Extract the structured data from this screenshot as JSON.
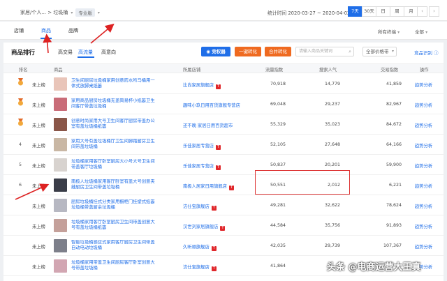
{
  "breadcrumb": {
    "path": "家居/个人... > 垃圾桶",
    "badge": "专业版"
  },
  "date": {
    "range": "统计时间 2020-03-27 ~ 2020-04-02",
    "buttons": [
      "7天",
      "30天",
      "日",
      "周",
      "月"
    ],
    "active": "7天"
  },
  "nav": {
    "tabs": [
      "店铺",
      "商品",
      "品牌"
    ],
    "active": "商品",
    "filters": [
      "所有终端",
      "全部"
    ]
  },
  "section": {
    "title": "商品排行",
    "tabs": [
      "高交易",
      "高流量",
      "高意向"
    ],
    "active_tab": "高流量",
    "logo": "竞权器",
    "btn1": "一键转化",
    "btn2": "合并转化",
    "search_placeholder": "请输入商品关键词",
    "select": "全部价格带",
    "explain": "竞品识别"
  },
  "columns": [
    "排名",
    "商品",
    "所属店铺",
    "流量指数",
    "搜索人气",
    "交易指数",
    "操作"
  ],
  "rows": [
    {
      "rank": "",
      "medal": true,
      "status": "未上榜",
      "name": "卫生间厨房垃圾桶家用创意防水所马桶用一体式放脚桌纸篓",
      "shop": "比尚家居旗舰店",
      "tmall": true,
      "flow": "70,918",
      "search": "14,779",
      "trade": "41,859",
      "op": "趋势分析",
      "thumb": "#e9c5b9"
    },
    {
      "rank": "",
      "medal": true,
      "status": "未上榜",
      "name": "家用商品厨房垃圾桶无盖简易杯小纸篓卫生间客厅带盖垃圾桶",
      "shop": "趣味小玖日用百货旗舰专营店",
      "tmall": false,
      "flow": "69,048",
      "search": "29,237",
      "trade": "82,967",
      "op": "趋势分析",
      "thumb": "#c96c78"
    },
    {
      "rank": "",
      "medal": true,
      "status": "未上榜",
      "name": "创意时尚家用大号卫生间客厅厨房带盖办公室有盖垃圾桶纸篓",
      "shop": "还不晚 家居日用百货超市",
      "tmall": false,
      "flow": "55,329",
      "search": "35,023",
      "trade": "84,672",
      "op": "趋势分析",
      "thumb": "#8a5648"
    },
    {
      "rank": "4",
      "medal": false,
      "status": "未上榜",
      "name": "家用大号有盖垃圾桶厅卫生间脚踏厨房卫生间带盖垃圾桶",
      "shop": "乐佳家居专营店",
      "tmall": true,
      "flow": "52,105",
      "search": "27,648",
      "trade": "64,166",
      "op": "趋势分析",
      "thumb": "#c9b7a4"
    },
    {
      "rank": "5",
      "medal": false,
      "status": "未上榜",
      "name": "垃圾桶家用客厅卧室厨房大小号大号卫生间带盖客厅垃圾桶",
      "shop": "乐佳家居专营店",
      "tmall": true,
      "flow": "50,837",
      "search": "20,201",
      "trade": "59,900",
      "op": "趋势分析",
      "thumb": "#d8d3cf"
    },
    {
      "rank": "6",
      "medal": false,
      "status": "未上榜",
      "name": "南极人垃圾桶家用客厅卧室有盖大号创意夹缝厨房卫生间带盖垃圾桶",
      "shop": "南极人居家日用旗舰店",
      "tmall": true,
      "flow": "50,551",
      "search": "2,012",
      "trade": "6,221",
      "op": "趋势分析",
      "thumb": "#3a3d48"
    },
    {
      "rank": "",
      "medal": false,
      "status": "未上榜",
      "name": "厨房垃圾桶挂式分类家用橱柜门挂壁式纸篓垃圾桶带盖厨余垃圾桶",
      "shop": "洁仕宝旗舰店",
      "tmall": true,
      "flow": "49,281",
      "search": "32,622",
      "trade": "78,624",
      "op": "趋势分析",
      "thumb": "#b7b8c2"
    },
    {
      "rank": "",
      "medal": false,
      "status": "未上榜",
      "name": "垃圾桶家用客厅卧室厨房卫生间带盖创意大号有盖垃圾桶纸篓",
      "shop": "汉世刘家居旗舰店",
      "tmall": true,
      "flow": "44,584",
      "search": "35,756",
      "trade": "91,893",
      "op": "趋势分析",
      "thumb": "#c4a09a"
    },
    {
      "rank": "",
      "medal": false,
      "status": "未上榜",
      "name": "智能垃圾桶感应式家用客厅厨房卫生间带盖自动电动垃圾桶",
      "shop": "久昕顺旗舰店",
      "tmall": true,
      "flow": "42,035",
      "search": "29,739",
      "trade": "107,367",
      "op": "趋势分析",
      "thumb": "#7d7f8a"
    },
    {
      "rank": "",
      "medal": false,
      "status": "未上榜",
      "name": "垃圾桶家用带盖卫生间厨房客厅卧室创意大号带盖垃圾桶",
      "shop": "洁仕宝旗舰店",
      "tmall": true,
      "flow": "41,864",
      "search": "",
      "trade": "",
      "op": "趋势分析",
      "thumb": "#d2a6b2"
    }
  ],
  "watermark": "头条 @电商运营大王真",
  "colors": {
    "accent": "#1f6ee8",
    "orange": "#ef6a20",
    "highlight": "#d33"
  }
}
